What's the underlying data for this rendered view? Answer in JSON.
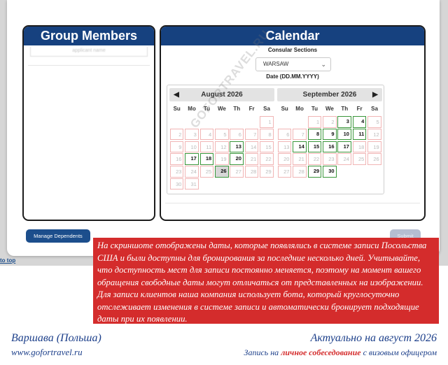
{
  "group_members": {
    "title": "Group Members",
    "member_placeholder": "applicant name"
  },
  "calendar": {
    "title": "Calendar",
    "consular_label": "Consular Sections",
    "selected_section": "WARSAW",
    "date_label": "Date (DD.MM.YYYY)",
    "weekdays": [
      "Su",
      "Mo",
      "Tu",
      "We",
      "Th",
      "Fr",
      "Sa"
    ],
    "months": [
      {
        "title": "August 2026",
        "weeks": [
          [
            null,
            null,
            null,
            null,
            null,
            null,
            1
          ],
          [
            2,
            3,
            4,
            5,
            6,
            7,
            8
          ],
          [
            9,
            10,
            11,
            12,
            13,
            14,
            15
          ],
          [
            16,
            17,
            18,
            19,
            20,
            21,
            22
          ],
          [
            23,
            24,
            25,
            26,
            27,
            28,
            29
          ],
          [
            30,
            31,
            null,
            null,
            null,
            null,
            null
          ]
        ],
        "available": [
          13,
          17,
          18,
          20,
          26
        ],
        "selected": [
          26
        ]
      },
      {
        "title": "September 2026",
        "weeks": [
          [
            null,
            null,
            1,
            2,
            3,
            4,
            5
          ],
          [
            6,
            7,
            8,
            9,
            10,
            11,
            12
          ],
          [
            13,
            14,
            15,
            16,
            17,
            18,
            19
          ],
          [
            20,
            21,
            22,
            23,
            24,
            25,
            26
          ],
          [
            27,
            28,
            29,
            30,
            null,
            null,
            null
          ]
        ],
        "available": [
          3,
          4,
          8,
          9,
          10,
          11,
          14,
          15,
          16,
          17,
          29,
          30
        ],
        "selected": []
      }
    ],
    "watermark": "GOFORTRAVEL.RU"
  },
  "buttons": {
    "manage_dependents": "Manage Dependents",
    "submit": "Submit",
    "back_to_top": "to top"
  },
  "notice": "На скриншоте отображены даты, которые появлялись в системе записи Посольства США и были доступны для бронирования за последние несколько дней. Учитывайте, что доступность мест для записи постоянно меняется, поэтому на момент вашего обращения свободные даты могут отличаться от представленных на изображении. Для записи клиентов наша компания использует бота, который круглосуточно отслеживает изменения в системе записи и автоматически бронирует подходящие даты при их появлении.",
  "footer": {
    "city": "Варшава (Польша)",
    "site": "www.gofortravel.ru",
    "updated": "Актуально на август 2026",
    "subtitle_before": "Запись на ",
    "subtitle_highlight": "личное собеседование",
    "subtitle_after": " с визовым офицером"
  },
  "colors": {
    "header_blue": "#16417f",
    "button_blue": "#1c4e8c",
    "notice_red": "#d42c2c",
    "available_green": "#3a963a",
    "unavailable_red": "#f1b5b5",
    "footer_blue": "#1c3f8a"
  }
}
